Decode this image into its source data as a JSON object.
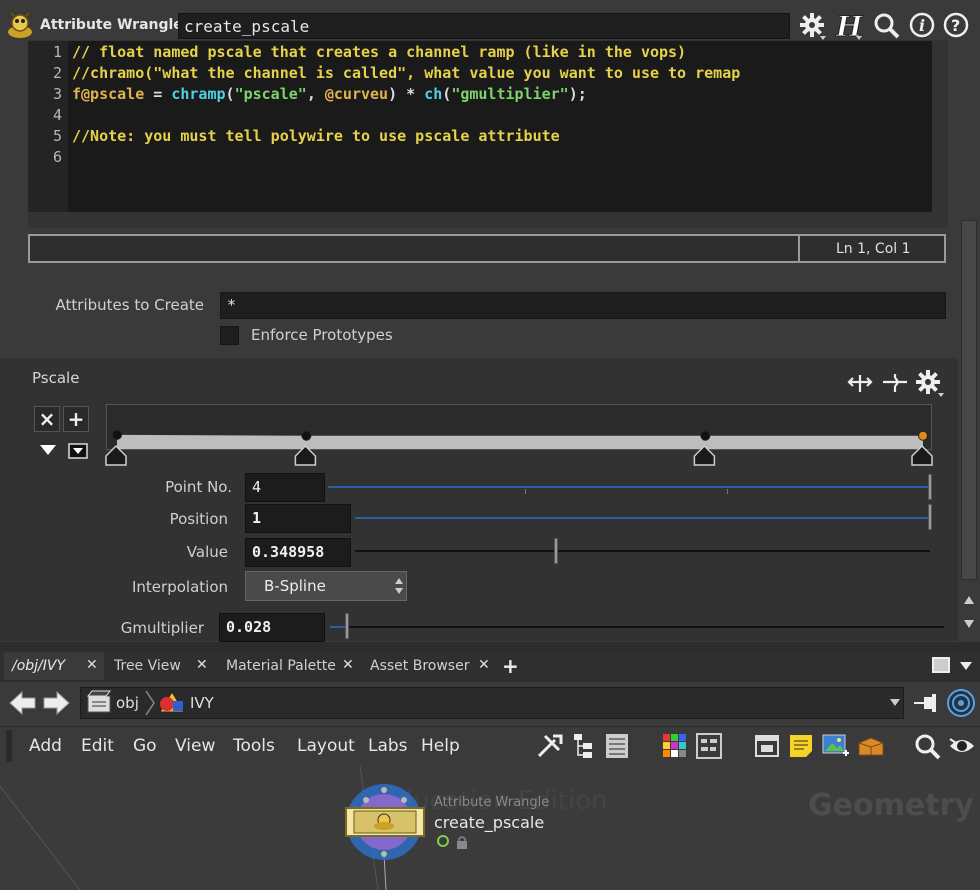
{
  "header": {
    "node_type": "Attribute Wrangle",
    "node_name": "create_pscale",
    "icons": [
      "gear-icon",
      "houdini-help-icon",
      "search-icon",
      "info-icon",
      "help-icon"
    ]
  },
  "editor": {
    "line_numbers": [
      "1",
      "2",
      "3",
      "4",
      "5",
      "6"
    ],
    "line1": "// float named pscale that creates a channel ramp (like in the vops)",
    "line2": "//chramo(\"what the channel is called\", what value you want to use to remap",
    "line3": {
      "var": "f@pscale",
      "op1": " = ",
      "fn1": "chramp",
      "p1": "(",
      "str1": "\"pscale\"",
      "sep": ", ",
      "attr": "@curveu",
      "op2": ") * ",
      "fn2": "ch",
      "p2": "(",
      "str2": "\"gmultiplier\"",
      "end": ");"
    },
    "line5": "//Note: you must tell polywire to use pscale attribute"
  },
  "status": {
    "cursor_position": "Ln 1, Col 1"
  },
  "attributes": {
    "create_label": "Attributes to Create",
    "create_value": "*",
    "enforce_label": "Enforce Prototypes"
  },
  "ramp": {
    "label": "Pscale",
    "point_no_label": "Point No.",
    "point_no_value": "4",
    "position_label": "Position",
    "position_value": "1",
    "value_label": "Value",
    "value_value": "0.348958",
    "interpolation_label": "Interpolation",
    "interpolation_value": "B-Spline",
    "gmultiplier_label": "Gmultiplier",
    "gmultiplier_value": "0.028",
    "keys": [
      {
        "position": 0.0,
        "value": 0.37
      },
      {
        "position": 0.235,
        "value": 0.35
      },
      {
        "position": 0.73,
        "value": 0.35
      },
      {
        "position": 1.0,
        "value": 0.348958
      }
    ],
    "selected_key": 3,
    "point_fraction": 1.0,
    "position_fraction": 1.0,
    "value_fraction": 0.348958,
    "gmultiplier_fraction": 0.028
  },
  "tabs": [
    {
      "label": "/obj/IVY"
    },
    {
      "label": "Tree View"
    },
    {
      "label": "Material Palette"
    },
    {
      "label": "Asset Browser"
    }
  ],
  "path": {
    "obj_label": "obj",
    "ivy_label": "IVY"
  },
  "menu": [
    "Add",
    "Edit",
    "Go",
    "View",
    "Tools",
    "Layout",
    "Labs",
    "Help"
  ],
  "network": {
    "context_label": "Geometry",
    "watermark": "Education Edition",
    "node_type": "Attribute Wrangle",
    "node_name": "create_pscale"
  },
  "colors": {
    "accent_blue": "#2b5fa8",
    "selected_key": "#e08a1e",
    "comment": "#e6d24a",
    "function": "#4fd1e4",
    "string": "#7ed36b"
  }
}
